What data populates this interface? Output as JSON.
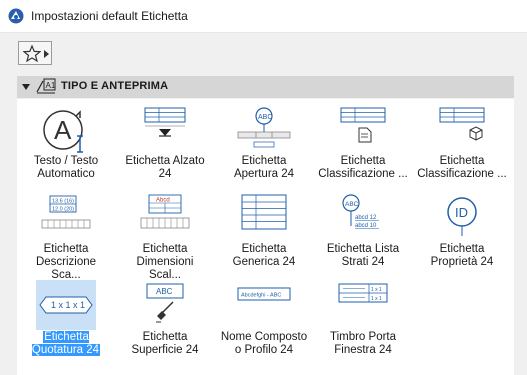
{
  "window": {
    "title": "Impostazioni default Etichetta"
  },
  "section": {
    "title": "TIPO E ANTEPRIMA"
  },
  "items": [
    {
      "label": "Testo / Testo\nAutomatico"
    },
    {
      "label": "Etichetta Alzato\n24"
    },
    {
      "label": "Etichetta\nApertura 24"
    },
    {
      "label": "Etichetta\nClassificazione ..."
    },
    {
      "label": "Etichetta\nClassificazione ..."
    },
    {
      "label": "Etichetta\nDescrizione Sca..."
    },
    {
      "label": "Etichetta\nDimensioni Scal..."
    },
    {
      "label": "Etichetta\nGenerica 24"
    },
    {
      "label": "Etichetta Lista\nStrati 24"
    },
    {
      "label": "Etichetta\nProprietà 24"
    },
    {
      "label": "Etichetta\nQuotatura 24"
    },
    {
      "label": "Etichetta\nSuperficie 24"
    },
    {
      "label": "Nome Composto\no Profilo 24"
    },
    {
      "label": "Timbro Porta\nFinestra 24"
    }
  ],
  "thumbs": {
    "apertura_badge": "ABC",
    "descrizione_rows": [
      "13.6 (16)",
      "12.0 (20)"
    ],
    "dimensioni_title": "Abcd",
    "lista_strati_badge": "ABC",
    "lista_strati_rows": [
      "abcd 12",
      "abcd 10"
    ],
    "proprieta_badge": "ID",
    "quotatura_text": "1 x 1 x 1",
    "superficie_text": "ABC",
    "composto_text": "Abcdefghi - ABC",
    "timbro_rows": [
      "1 x 1",
      "1 x 1"
    ]
  },
  "selected_index": 10,
  "colors": {
    "selection": "#3399ff",
    "selection_thumb": "#c9e0f7",
    "icon_blue": "#1f5fa8"
  }
}
